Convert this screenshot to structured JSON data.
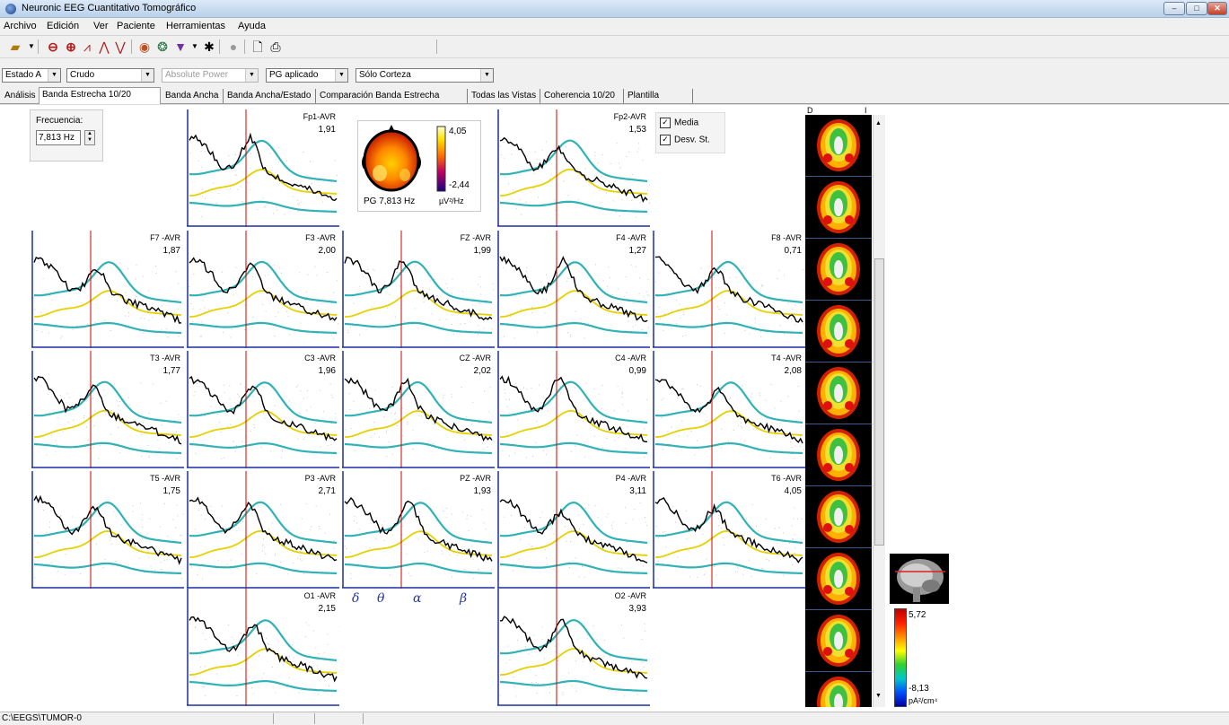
{
  "window": {
    "title": "Neuronic EEG Cuantitativo Tomográfico"
  },
  "menu": [
    "Archivo",
    "Edición",
    "Ver",
    "Paciente",
    "Herramientas",
    "Ayuda"
  ],
  "selectors": {
    "state": "Estado A",
    "data": "Crudo",
    "measure": "Absolute Power",
    "correction": "PG aplicado",
    "region": "Sólo Corteza"
  },
  "tabs": [
    "Análisis",
    "Banda Estrecha 10/20",
    "Banda Ancha",
    "Banda Ancha/Estado",
    "Comparación Banda Estrecha 10/20",
    "Todas las Vistas",
    "Coherencia 10/20",
    "Plantilla Usuario"
  ],
  "frequency": {
    "label": "Frecuencia:",
    "value": "7,813 Hz"
  },
  "headmap": {
    "max": "4,05",
    "min": "-2,44",
    "caption": "PG 7,813 Hz",
    "unit": "µV²/Hz"
  },
  "options": {
    "media": "Media",
    "desv": "Desv. St.",
    "media_checked": true,
    "desv_checked": true
  },
  "channels": [
    {
      "name": "Fp1-AVR",
      "value": "1,91"
    },
    {
      "name": "Fp2-AVR",
      "value": "1,53"
    },
    {
      "name": "F7 -AVR",
      "value": "1,87"
    },
    {
      "name": "F3 -AVR",
      "value": "2,00"
    },
    {
      "name": "FZ -AVR",
      "value": "1,99"
    },
    {
      "name": "F4 -AVR",
      "value": "1,27"
    },
    {
      "name": "F8 -AVR",
      "value": "0,71"
    },
    {
      "name": "T3 -AVR",
      "value": "1,77"
    },
    {
      "name": "C3 -AVR",
      "value": "1,96"
    },
    {
      "name": "CZ -AVR",
      "value": "2,02"
    },
    {
      "name": "C4 -AVR",
      "value": "0,99"
    },
    {
      "name": "T4 -AVR",
      "value": "2,08"
    },
    {
      "name": "T5 -AVR",
      "value": "1,75"
    },
    {
      "name": "P3 -AVR",
      "value": "2,71"
    },
    {
      "name": "PZ -AVR",
      "value": "1,93"
    },
    {
      "name": "P4 -AVR",
      "value": "3,11"
    },
    {
      "name": "T6 -AVR",
      "value": "4,05"
    },
    {
      "name": "O1 -AVR",
      "value": "2,15"
    },
    {
      "name": "O2 -AVR",
      "value": "3,93"
    }
  ],
  "bands": [
    "δ",
    "θ",
    "α",
    "β"
  ],
  "brain_strip": {
    "left_label": "D",
    "right_label": "I"
  },
  "colorbar": {
    "max": "5,72",
    "min": "-8,13",
    "unit": "pA²/cm⁴"
  },
  "status": {
    "path": "C:\\EEGS\\TUMOR-0"
  },
  "colors": {
    "mean_curve": "#e6d000",
    "sd_curve": "#31b2b6",
    "patient_curve": "#000000",
    "marker": "#d00000",
    "axis": "#1c2fa0"
  }
}
